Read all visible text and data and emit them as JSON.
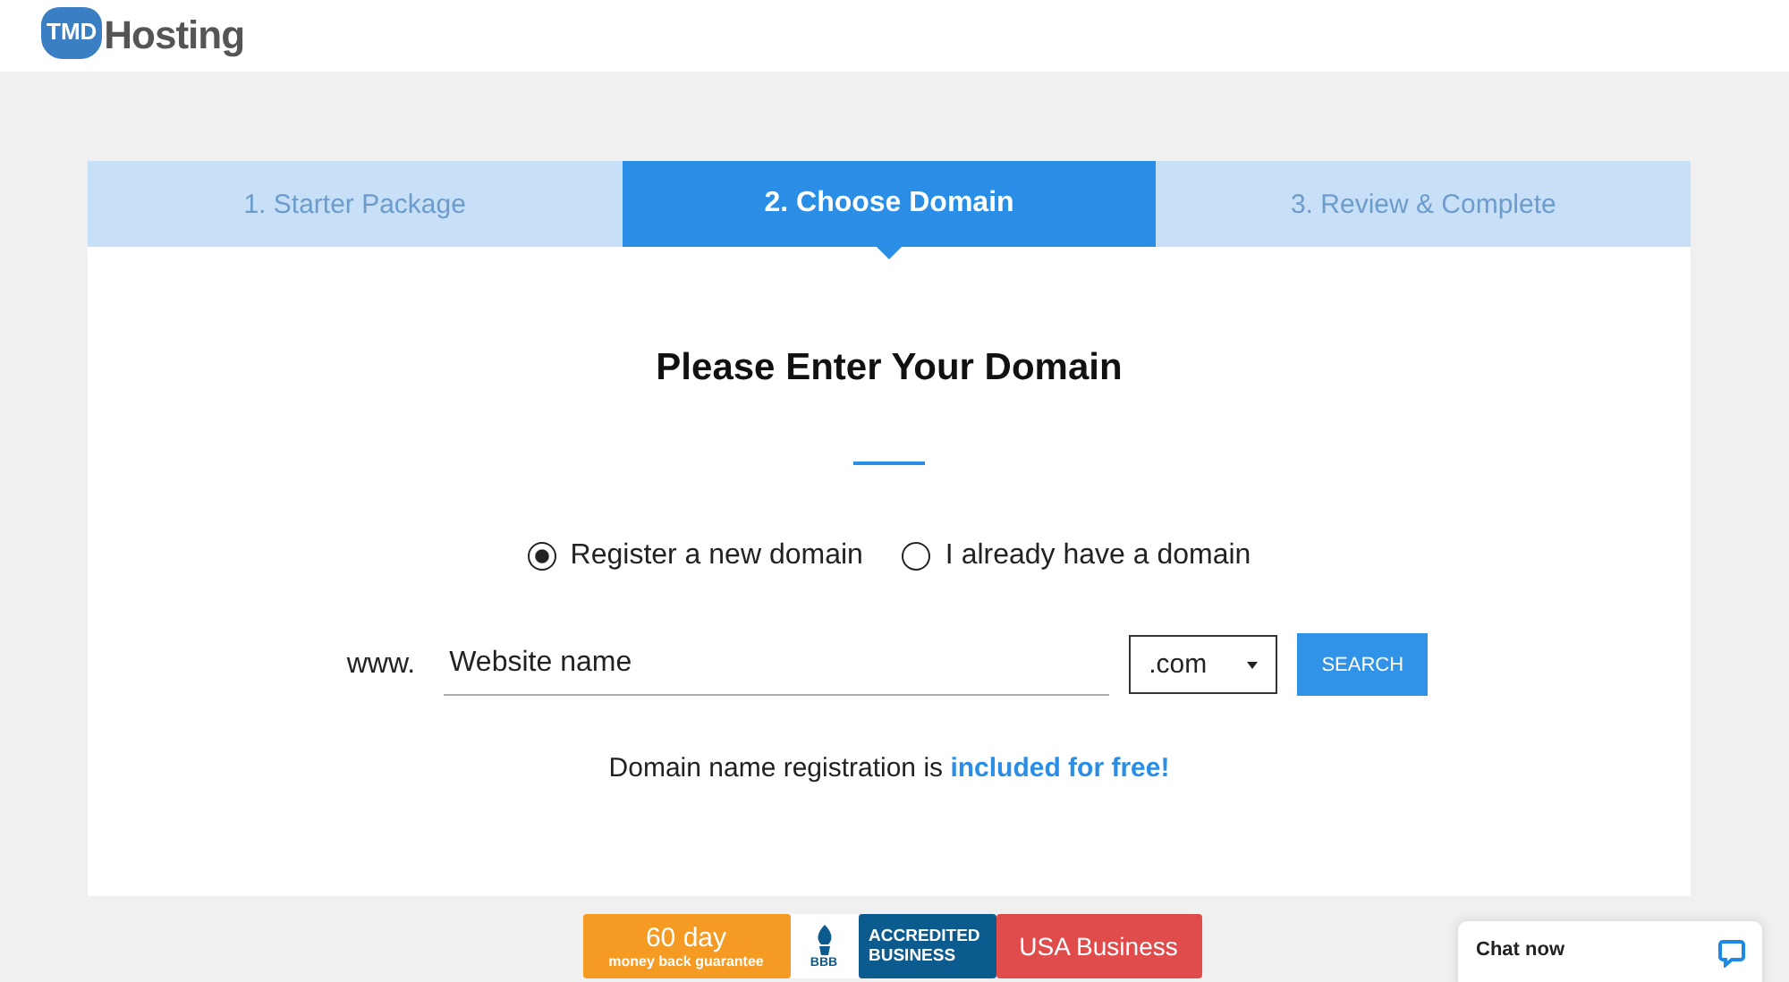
{
  "header": {
    "logo": {
      "badge": "TMD",
      "word": "Hosting"
    }
  },
  "steps": [
    {
      "label": "1. Starter Package",
      "selected": false
    },
    {
      "label": "2. Choose Domain",
      "selected": true
    },
    {
      "label": "3. Review & Complete",
      "selected": false
    }
  ],
  "heading": "Please Enter Your Domain",
  "options": [
    {
      "label": "Register a new domain",
      "selected": true
    },
    {
      "label": "I already have a domain",
      "selected": false
    }
  ],
  "domain_form": {
    "prefix": "www.",
    "placeholder": "Website name",
    "extension": ".com",
    "button": "SEARCH"
  },
  "note": "Domain name registration is **included for free!**",
  "badges": [
    {
      "kind": "guarantee",
      "title": "60 day",
      "subtitle": "money back guarantee"
    },
    {
      "kind": "bbb",
      "mark": "BBB",
      "title": "ACCREDITED",
      "subtitle": "BUSINESS"
    },
    {
      "kind": "usa",
      "title": "USA Business"
    }
  ],
  "chat": {
    "label": "Chat now"
  }
}
